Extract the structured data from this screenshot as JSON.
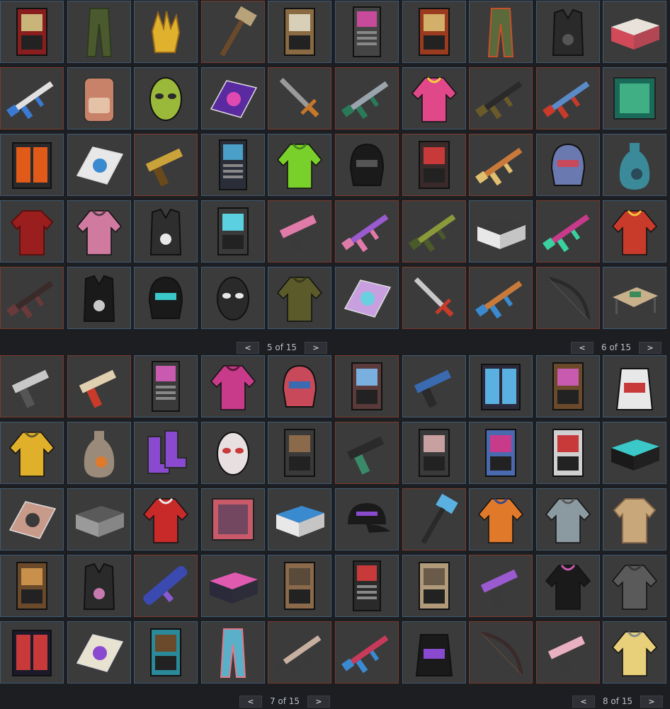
{
  "pagers": {
    "top_left": {
      "prev": "<",
      "label": "5 of 15",
      "next": ">"
    },
    "top_right": {
      "prev": "<",
      "label": "6 of 15",
      "next": ">"
    },
    "bottom_left": {
      "prev": "<",
      "label": "7 of 15",
      "next": ">"
    },
    "bottom_right": {
      "prev": "<",
      "label": "8 of 15",
      "next": ">"
    }
  },
  "colors": {
    "tile_bg": "#3b3b3b",
    "border_blue": "#3f5a72",
    "border_red": "#7b3a2c",
    "page_bg": "#1c1e22"
  },
  "grid_top": [
    {
      "item": "armored-door-skin",
      "border": "blue",
      "kind": "door",
      "c1": "#8a1e1e",
      "c2": "#c9b47a"
    },
    {
      "item": "camo-pants",
      "border": "blue",
      "kind": "pants",
      "c1": "#4a5a2e",
      "c2": "#2e3a1e"
    },
    {
      "item": "gloves",
      "border": "blue",
      "kind": "gloves",
      "c1": "#e0b12c",
      "c2": "#9a6a1a"
    },
    {
      "item": "sledgehammer",
      "border": "red",
      "kind": "hammer",
      "c1": "#b7a27a",
      "c2": "#6a4a2a"
    },
    {
      "item": "wood-double-door",
      "border": "blue",
      "kind": "door",
      "c1": "#8a6a42",
      "c2": "#d8cfb8"
    },
    {
      "item": "vending-machine",
      "border": "blue",
      "kind": "machine",
      "c1": "#444",
      "c2": "#c84a9a"
    },
    {
      "item": "wood-door-skin",
      "border": "blue",
      "kind": "door",
      "c1": "#9a3a1e",
      "c2": "#d3b06a"
    },
    {
      "item": "camo-pants-2",
      "border": "blue",
      "kind": "pants",
      "c1": "#5a6a3a",
      "c2": "#c7502a"
    },
    {
      "item": "armor-vest",
      "border": "blue",
      "kind": "vest",
      "c1": "#2a2a2a",
      "c2": "#555"
    },
    {
      "item": "large-box",
      "border": "blue",
      "kind": "box",
      "c1": "#d24a5a",
      "c2": "#e8e2da"
    },
    {
      "item": "rifle-white",
      "border": "red",
      "kind": "rifle",
      "c1": "#e0e0e0",
      "c2": "#3a7ad0"
    },
    {
      "item": "backpack",
      "border": "blue",
      "kind": "backpack",
      "c1": "#c9826a",
      "c2": "#e3c2a8"
    },
    {
      "item": "alien-mask",
      "border": "blue",
      "kind": "mask",
      "c1": "#9ab83a",
      "c2": "#2a2a2a"
    },
    {
      "item": "rug-neon",
      "border": "blue",
      "kind": "rug",
      "c1": "#5a2aa0",
      "c2": "#e04ab0"
    },
    {
      "item": "machete",
      "border": "red",
      "kind": "sword",
      "c1": "#9a9a9a",
      "c2": "#c7772a"
    },
    {
      "item": "rifle-grey",
      "border": "red",
      "kind": "rifle",
      "c1": "#9aa4ad",
      "c2": "#2a7a5a"
    },
    {
      "item": "pink-hoodie",
      "border": "blue",
      "kind": "hoodie",
      "c1": "#e0488a",
      "c2": "#f4d03a"
    },
    {
      "item": "m4-rifle",
      "border": "red",
      "kind": "rifle",
      "c1": "#2a2a2a",
      "c2": "#6a5a2a"
    },
    {
      "item": "blue-rifle",
      "border": "red",
      "kind": "rifle",
      "c1": "#5a8ac8",
      "c2": "#c83a2a"
    },
    {
      "item": "neon-sign",
      "border": "blue",
      "kind": "sign",
      "c1": "#1a6a5a",
      "c2": "#5ae0a0"
    },
    {
      "item": "furnace-locker",
      "border": "blue",
      "kind": "locker",
      "c1": "#2a2a2a",
      "c2": "#e05a1a"
    },
    {
      "item": "sticker-rug",
      "border": "blue",
      "kind": "rug",
      "c1": "#e8e8e8",
      "c2": "#3a8ad0"
    },
    {
      "item": "gold-pistol",
      "border": "red",
      "kind": "pistol",
      "c1": "#c9a23a",
      "c2": "#6a4a1a"
    },
    {
      "item": "arcade-locker",
      "border": "blue",
      "kind": "machine",
      "c1": "#2a2e38",
      "c2": "#4aa0c8"
    },
    {
      "item": "green-jacket",
      "border": "blue",
      "kind": "hoodie",
      "c1": "#7ad02a",
      "c2": "#4a8a1a"
    },
    {
      "item": "black-helmet",
      "border": "red",
      "kind": "helmet",
      "c1": "#1a1a1a",
      "c2": "#555"
    },
    {
      "item": "red-door",
      "border": "red",
      "kind": "door",
      "c1": "#3a2a2a",
      "c2": "#c83a3a"
    },
    {
      "item": "shotgun",
      "border": "red",
      "kind": "rifle",
      "c1": "#c97a3a",
      "c2": "#e0c070"
    },
    {
      "item": "metal-face-mask",
      "border": "blue",
      "kind": "helmet",
      "c1": "#6a7ab0",
      "c2": "#c84a5a"
    },
    {
      "item": "vase",
      "border": "blue",
      "kind": "vase",
      "c1": "#3a8a9a",
      "c2": "#2a4a5a"
    },
    {
      "item": "red-shirt",
      "border": "blue",
      "kind": "shirt",
      "c1": "#9a1e1e",
      "c2": "#5a1010"
    },
    {
      "item": "pink-jacket",
      "border": "blue",
      "kind": "hoodie",
      "c1": "#d07aa0",
      "c2": "#5a3a4a"
    },
    {
      "item": "skull-vest",
      "border": "blue",
      "kind": "vest",
      "c1": "#2e2e2e",
      "c2": "#e8e8e8"
    },
    {
      "item": "neon-door",
      "border": "blue",
      "kind": "door",
      "c1": "#3a3a3a",
      "c2": "#5ad0e0"
    },
    {
      "item": "pink-smg",
      "border": "red",
      "kind": "pistol",
      "c1": "#e07aa8",
      "c2": "#3a3a3a"
    },
    {
      "item": "purple-rifle",
      "border": "red",
      "kind": "rifle",
      "c1": "#9a5ad0",
      "c2": "#e07aa8"
    },
    {
      "item": "camo-rifle",
      "border": "red",
      "kind": "rifle",
      "c1": "#8a9a3a",
      "c2": "#4a5a2a"
    },
    {
      "item": "crate",
      "border": "blue",
      "kind": "box",
      "c1": "#e8e8e8",
      "c2": "#3a3a3a"
    },
    {
      "item": "neon-smg",
      "border": "red",
      "kind": "rifle",
      "c1": "#c83a8a",
      "c2": "#3ad0a0"
    },
    {
      "item": "red-jacket",
      "border": "blue",
      "kind": "hoodie",
      "c1": "#c83a2a",
      "c2": "#f4c03a"
    },
    {
      "item": "dark-rifle",
      "border": "red",
      "kind": "rifle",
      "c1": "#3a2a2a",
      "c2": "#6a3a3a"
    },
    {
      "item": "black-poncho",
      "border": "blue",
      "kind": "vest",
      "c1": "#1a1a1a",
      "c2": "#c8c8c8"
    },
    {
      "item": "hood-mask",
      "border": "blue",
      "kind": "helmet",
      "c1": "#1a1a1a",
      "c2": "#3ac8c8"
    },
    {
      "item": "teeth-bandana",
      "border": "blue",
      "kind": "mask",
      "c1": "#2a2a2a",
      "c2": "#e8e8e8"
    },
    {
      "item": "camo-jacket",
      "border": "blue",
      "kind": "hoodie",
      "c1": "#5a5a2a",
      "c2": "#3a3a1a"
    },
    {
      "item": "holo-rug",
      "border": "blue",
      "kind": "rug",
      "c1": "#c8a0e0",
      "c2": "#6ad0e0"
    },
    {
      "item": "salvaged-sword",
      "border": "red",
      "kind": "sword",
      "c1": "#c8c8c8",
      "c2": "#c83a2a"
    },
    {
      "item": "graffiti-rifle",
      "border": "red",
      "kind": "rifle",
      "c1": "#c87a3a",
      "c2": "#3a8ad0"
    },
    {
      "item": "bow",
      "border": "red",
      "kind": "bow",
      "c1": "#2a2a2a",
      "c2": "#555"
    },
    {
      "item": "table",
      "border": "blue",
      "kind": "table",
      "c1": "#c8b08a",
      "c2": "#3a8a5a"
    }
  ],
  "grid_bottom": [
    {
      "item": "revolver",
      "border": "red",
      "kind": "pistol",
      "c1": "#c8c8c8",
      "c2": "#555"
    },
    {
      "item": "ornate-pistol",
      "border": "red",
      "kind": "pistol",
      "c1": "#e0d0b0",
      "c2": "#c83a2a"
    },
    {
      "item": "vending-machine-2",
      "border": "blue",
      "kind": "machine",
      "c1": "#3a3a3a",
      "c2": "#c85ab0"
    },
    {
      "item": "pink-hoodie-2",
      "border": "blue",
      "kind": "hoodie",
      "c1": "#c83a8a",
      "c2": "#5a1a3a"
    },
    {
      "item": "glass-face-mask",
      "border": "blue",
      "kind": "helmet",
      "c1": "#c84a5a",
      "c2": "#3a6ab0"
    },
    {
      "item": "graffiti-door",
      "border": "red",
      "kind": "door",
      "c1": "#5a3a3a",
      "c2": "#7ab0e0"
    },
    {
      "item": "blue-gun",
      "border": "blue",
      "kind": "pistol",
      "c1": "#3a6ab0",
      "c2": "#2a2a2a"
    },
    {
      "item": "fridge",
      "border": "blue",
      "kind": "locker",
      "c1": "#2a2a3a",
      "c2": "#5ab0e0"
    },
    {
      "item": "neon-door-2",
      "border": "blue",
      "kind": "door",
      "c1": "#6a4a2a",
      "c2": "#c85ab0"
    },
    {
      "item": "rocket-sleeping-bag",
      "border": "blue",
      "kind": "bag",
      "c1": "#e8e8e8",
      "c2": "#c83a3a"
    },
    {
      "item": "yellow-jacket",
      "border": "blue",
      "kind": "hoodie",
      "c1": "#e0b02a",
      "c2": "#6a5a2a"
    },
    {
      "item": "lava-vase",
      "border": "blue",
      "kind": "vase",
      "c1": "#9a8a7a",
      "c2": "#e07a2a"
    },
    {
      "item": "purple-boots",
      "border": "blue",
      "kind": "boots",
      "c1": "#8a4ad0",
      "c2": "#2a2a2a"
    },
    {
      "item": "clown-mask",
      "border": "blue",
      "kind": "mask",
      "c1": "#e8e0e0",
      "c2": "#c83a3a"
    },
    {
      "item": "garage-door",
      "border": "blue",
      "kind": "door",
      "c1": "#3a3a3a",
      "c2": "#8a6a4a"
    },
    {
      "item": "dark-smg",
      "border": "red",
      "kind": "pistol",
      "c1": "#2a2a2a",
      "c2": "#3a8a6a"
    },
    {
      "item": "poster-door",
      "border": "blue",
      "kind": "door",
      "c1": "#3a3a3a",
      "c2": "#c8a0a0"
    },
    {
      "item": "graffiti-locker",
      "border": "blue",
      "kind": "door",
      "c1": "#4a6ab0",
      "c2": "#c83a8a"
    },
    {
      "item": "shattered-door",
      "border": "blue",
      "kind": "door",
      "c1": "#d0d0d0",
      "c2": "#c83a3a"
    },
    {
      "item": "glow-box",
      "border": "blue",
      "kind": "box",
      "c1": "#1a1a1a",
      "c2": "#3ac8c8"
    },
    {
      "item": "pink-rug",
      "border": "blue",
      "kind": "rug",
      "c1": "#c89a8a",
      "c2": "#3a3a3a"
    },
    {
      "item": "metal-box",
      "border": "blue",
      "kind": "box",
      "c1": "#9a9a9a",
      "c2": "#5a5a5a"
    },
    {
      "item": "santa-coat",
      "border": "blue",
      "kind": "hoodie",
      "c1": "#c82a2a",
      "c2": "#e8e8e8"
    },
    {
      "item": "ohshit-banner",
      "border": "blue",
      "kind": "sign",
      "c1": "#c85a6a",
      "c2": "#3a3a5a"
    },
    {
      "item": "striped-box",
      "border": "blue",
      "kind": "box",
      "c1": "#e8e8e8",
      "c2": "#3a8ad0"
    },
    {
      "item": "rivals-cap",
      "border": "blue",
      "kind": "cap",
      "c1": "#1a1a1a",
      "c2": "#8a4ad0"
    },
    {
      "item": "rainbow-hammer",
      "border": "red",
      "kind": "hammer",
      "c1": "#5ab0e0",
      "c2": "#2a2a2a"
    },
    {
      "item": "orange-hoodie",
      "border": "blue",
      "kind": "hoodie",
      "c1": "#e07a2a",
      "c2": "#3a4a8a"
    },
    {
      "item": "grey-hoodie",
      "border": "blue",
      "kind": "hoodie",
      "c1": "#8a9aa0",
      "c2": "#5a5a5a"
    },
    {
      "item": "tan-shirt",
      "border": "blue",
      "kind": "shirt",
      "c1": "#c8a87a",
      "c2": "#8a6a4a"
    },
    {
      "item": "painted-door",
      "border": "blue",
      "kind": "door",
      "c1": "#6a4a2a",
      "c2": "#c8904a"
    },
    {
      "item": "galaxy-armor",
      "border": "blue",
      "kind": "vest",
      "c1": "#2a2a2a",
      "c2": "#c87ab0"
    },
    {
      "item": "rocket-launcher",
      "border": "red",
      "kind": "launcher",
      "c1": "#3a4ab0",
      "c2": "#8a5ad0"
    },
    {
      "item": "neon-box",
      "border": "blue",
      "kind": "box",
      "c1": "#2a2a3a",
      "c2": "#e05ab0"
    },
    {
      "item": "wood-crate-door",
      "border": "blue",
      "kind": "door",
      "c1": "#8a6a4a",
      "c2": "#5a4a3a"
    },
    {
      "item": "vending-rivals",
      "border": "blue",
      "kind": "machine",
      "c1": "#2a2a2a",
      "c2": "#c83a3a"
    },
    {
      "item": "bookshelf",
      "border": "blue",
      "kind": "door",
      "c1": "#b09a7a",
      "c2": "#6a5a4a"
    },
    {
      "item": "purple-smg",
      "border": "red",
      "kind": "pistol",
      "c1": "#9a5ad0",
      "c2": "#3a3a3a"
    },
    {
      "item": "skeleton-hoodie",
      "border": "blue",
      "kind": "hoodie",
      "c1": "#1a1a1a",
      "c2": "#c85ab0"
    },
    {
      "item": "grey-jacket",
      "border": "blue",
      "kind": "hoodie",
      "c1": "#5a5a5a",
      "c2": "#3a3a3a"
    },
    {
      "item": "triple-locker",
      "border": "blue",
      "kind": "locker",
      "c1": "#1a1a2a",
      "c2": "#c83a3a"
    },
    {
      "item": "paper-rug",
      "border": "blue",
      "kind": "rug",
      "c1": "#e8e2d0",
      "c2": "#8a4ad0"
    },
    {
      "item": "teal-double-door",
      "border": "blue",
      "kind": "door",
      "c1": "#2a8a9a",
      "c2": "#6a4a2a"
    },
    {
      "item": "floral-pants",
      "border": "blue",
      "kind": "pants",
      "c1": "#5ab0c8",
      "c2": "#e07a8a"
    },
    {
      "item": "tan-rifle",
      "border": "red",
      "kind": "rifle",
      "c1": "#c8b0a0",
      "c2": "#3a3a3a"
    },
    {
      "item": "rainbow-rifle",
      "border": "red",
      "kind": "rifle",
      "c1": "#c83a5a",
      "c2": "#3a8ad0"
    },
    {
      "item": "rivals-bag",
      "border": "blue",
      "kind": "bag",
      "c1": "#1a1a1a",
      "c2": "#8a4ad0"
    },
    {
      "item": "dark-bow",
      "border": "red",
      "kind": "bow",
      "c1": "#3a2a2a",
      "c2": "#6a4a3a"
    },
    {
      "item": "pink-pistol",
      "border": "red",
      "kind": "pistol",
      "c1": "#e8b0c0",
      "c2": "#3a3a3a"
    },
    {
      "item": "yellow-jacket-2",
      "border": "blue",
      "kind": "hoodie",
      "c1": "#e8d07a",
      "c2": "#8a8a8a"
    }
  ]
}
